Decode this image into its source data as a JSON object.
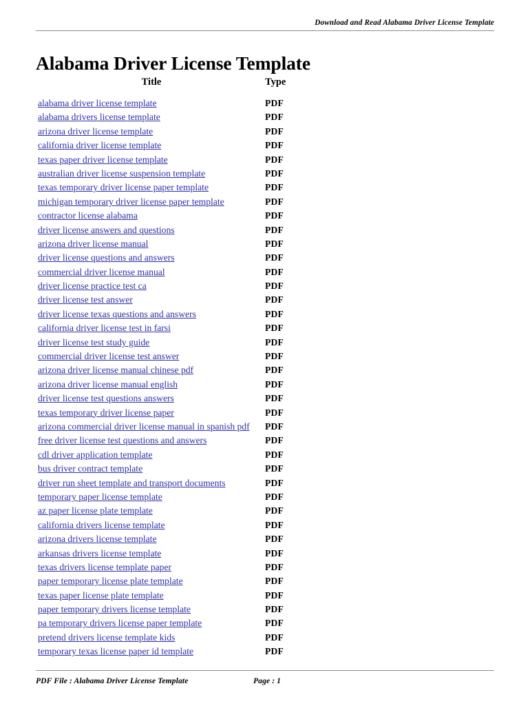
{
  "header": {
    "running_title": "Download and Read Alabama Driver License Template"
  },
  "title": "Alabama Driver License Template",
  "table": {
    "columns": [
      "Title",
      "Type"
    ],
    "col_title_label": "Title",
    "col_type_label": "Type",
    "link_color": "#3030a8",
    "rows": [
      {
        "title": "alabama driver license template",
        "type": "PDF"
      },
      {
        "title": "alabama drivers license template",
        "type": "PDF"
      },
      {
        "title": "arizona driver license template",
        "type": "PDF"
      },
      {
        "title": "california driver license template",
        "type": "PDF"
      },
      {
        "title": "texas paper driver license template",
        "type": "PDF"
      },
      {
        "title": "australian driver license suspension template",
        "type": "PDF"
      },
      {
        "title": "texas temporary driver license paper template",
        "type": "PDF"
      },
      {
        "title": "michigan temporary driver license paper template",
        "type": "PDF"
      },
      {
        "title": "contractor license alabama",
        "type": "PDF"
      },
      {
        "title": "driver license answers and questions",
        "type": "PDF"
      },
      {
        "title": "arizona driver license manual",
        "type": "PDF"
      },
      {
        "title": "driver license questions and answers",
        "type": "PDF"
      },
      {
        "title": "commercial driver license manual",
        "type": "PDF"
      },
      {
        "title": "driver license practice test ca",
        "type": "PDF"
      },
      {
        "title": "driver license test answer",
        "type": "PDF"
      },
      {
        "title": "driver license texas questions and answers",
        "type": "PDF"
      },
      {
        "title": "california driver license test in farsi",
        "type": "PDF"
      },
      {
        "title": "driver license test study guide",
        "type": "PDF"
      },
      {
        "title": "commercial driver license test answer",
        "type": "PDF"
      },
      {
        "title": "arizona driver license manual chinese pdf",
        "type": "PDF"
      },
      {
        "title": "arizona driver license manual english",
        "type": "PDF"
      },
      {
        "title": "driver license test questions answers",
        "type": "PDF"
      },
      {
        "title": "texas temporary driver license paper",
        "type": "PDF"
      },
      {
        "title": "arizona commercial driver license manual in spanish pdf",
        "type": "PDF"
      },
      {
        "title": "free driver license test questions and answers",
        "type": "PDF"
      },
      {
        "title": "cdl driver application template",
        "type": "PDF"
      },
      {
        "title": "bus driver contract template",
        "type": "PDF"
      },
      {
        "title": "driver run sheet template and transport documents",
        "type": "PDF"
      },
      {
        "title": "temporary paper license template",
        "type": "PDF"
      },
      {
        "title": "az paper license plate template",
        "type": "PDF"
      },
      {
        "title": "california drivers license template",
        "type": "PDF"
      },
      {
        "title": "arizona drivers license template",
        "type": "PDF"
      },
      {
        "title": "arkansas drivers license template",
        "type": "PDF"
      },
      {
        "title": "texas drivers license template paper",
        "type": "PDF"
      },
      {
        "title": "paper temporary license plate template",
        "type": "PDF"
      },
      {
        "title": "texas paper license plate template",
        "type": "PDF"
      },
      {
        "title": "paper temporary drivers license template",
        "type": "PDF"
      },
      {
        "title": "pa temporary drivers license paper template",
        "type": "PDF"
      },
      {
        "title": "pretend drivers license template kids",
        "type": "PDF"
      },
      {
        "title": "temporary texas license paper id template",
        "type": "PDF"
      }
    ]
  },
  "footer": {
    "file_label": "PDF File : Alabama Driver License Template",
    "page_label": "Page : 1"
  }
}
